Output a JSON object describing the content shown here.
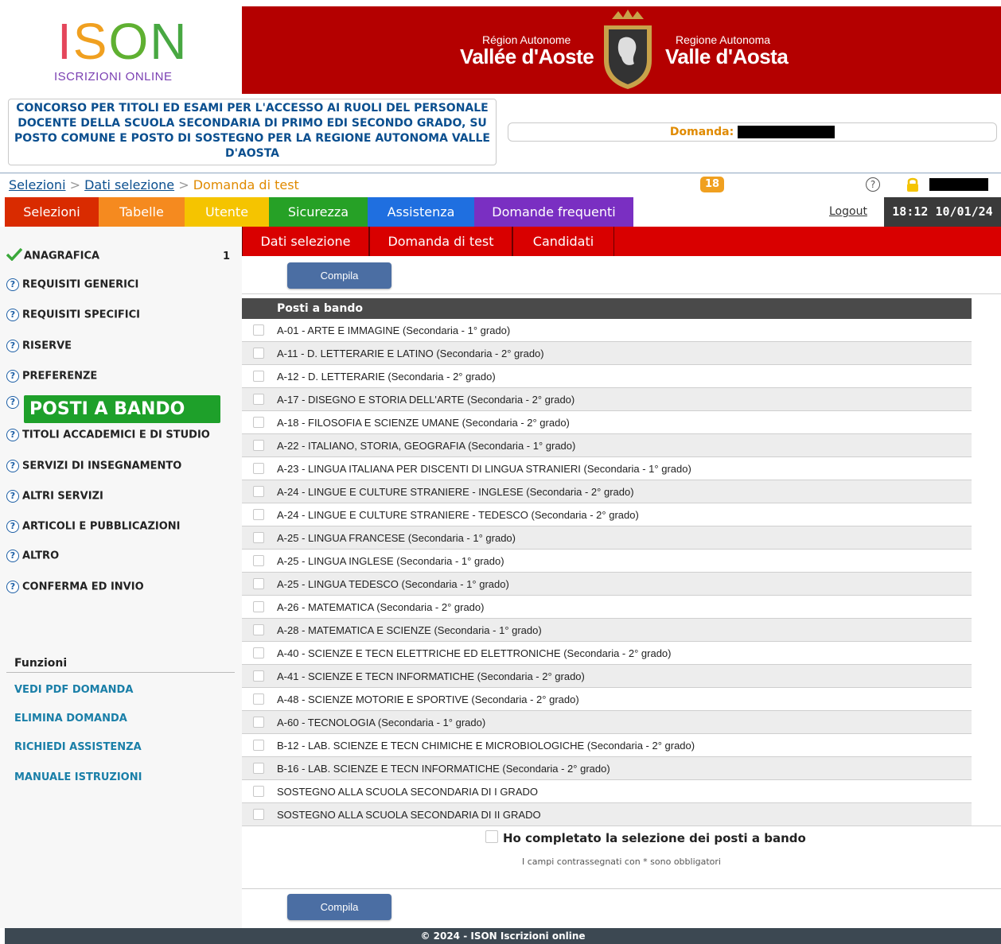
{
  "logo": {
    "letters": [
      "I",
      "S",
      "O",
      "N"
    ],
    "subtitle": "ISCRIZIONI ONLINE"
  },
  "region": {
    "fr_small": "Région Autonome",
    "fr_big": "Vallée d'Aoste",
    "it_small": "Regione Autonoma",
    "it_big": "Valle d'Aosta"
  },
  "concorso_title": "CONCORSO PER TITOLI ED ESAMI PER L'ACCESSO AI RUOLI DEL PERSONALE DOCENTE DELLA SCUOLA SECONDARIA DI PRIMO EDI SECONDO GRADO, SU POSTO COMUNE E POSTO DI SOSTEGNO PER LA REGIONE AUTONOMA VALLE D'AOSTA",
  "domanda_label": "Domanda:",
  "breadcrumb": {
    "items": [
      "Selezioni",
      "Dati selezione",
      "Domanda di test"
    ],
    "separator": ">"
  },
  "badge_count": "18",
  "nav": {
    "items": [
      {
        "label": "Selezioni",
        "color": "#d92b00"
      },
      {
        "label": "Tabelle",
        "color": "#f58a1f"
      },
      {
        "label": "Utente",
        "color": "#f5c400"
      },
      {
        "label": "Sicurezza",
        "color": "#26a126"
      },
      {
        "label": "Assistenza",
        "color": "#1f6fe0"
      },
      {
        "label": "Domande frequenti",
        "color": "#7a2fc2"
      }
    ],
    "logout": "Logout",
    "datetime": "18:12 10/01/24"
  },
  "subtabs": [
    "Dati selezione",
    "Domanda di test",
    "Candidati"
  ],
  "sidebar": {
    "sections": [
      {
        "label": "ANAGRAFICA",
        "status": "done",
        "count": "1"
      },
      {
        "label": "REQUISITI GENERICI",
        "status": "help"
      },
      {
        "label": "REQUISITI SPECIFICI",
        "status": "help"
      },
      {
        "label": "RISERVE",
        "status": "help"
      },
      {
        "label": "PREFERENZE",
        "status": "help"
      },
      {
        "label": "POSTI A BANDO",
        "status": "active"
      },
      {
        "label": "TITOLI ACCADEMICI E DI STUDIO",
        "status": "help"
      },
      {
        "label": "SERVIZI DI INSEGNAMENTO",
        "status": "help"
      },
      {
        "label": "ALTRI SERVIZI",
        "status": "help"
      },
      {
        "label": "ARTICOLI E PUBBLICAZIONI",
        "status": "help"
      },
      {
        "label": "ALTRO",
        "status": "help"
      },
      {
        "label": "CONFERMA ED INVIO",
        "status": "help"
      }
    ],
    "funzioni_title": "Funzioni",
    "funzioni": [
      "VEDI PDF DOMANDA",
      "ELIMINA DOMANDA",
      "RICHIEDI ASSISTENZA",
      "MANUALE ISTRUZIONI"
    ]
  },
  "compila_label": "Compila",
  "table": {
    "header": "Posti a bando",
    "rows": [
      "A-01 - ARTE E IMMAGINE (Secondaria - 1° grado)",
      "A-11 - D. LETTERARIE E LATINO (Secondaria - 2° grado)",
      "A-12 - D. LETTERARIE (Secondaria - 2° grado)",
      "A-17 - DISEGNO E STORIA DELL'ARTE (Secondaria - 2° grado)",
      "A-18 - FILOSOFIA E SCIENZE UMANE (Secondaria - 2° grado)",
      "A-22 - ITALIANO, STORIA, GEOGRAFIA (Secondaria - 1° grado)",
      "A-23 - LINGUA ITALIANA PER DISCENTI DI LINGUA STRANIERI (Secondaria - 1° grado)",
      "A-24 - LINGUE E CULTURE STRANIERE - INGLESE (Secondaria - 2° grado)",
      "A-24 - LINGUE E CULTURE STRANIERE - TEDESCO (Secondaria - 2° grado)",
      "A-25 - LINGUA FRANCESE (Secondaria - 1° grado)",
      "A-25 - LINGUA INGLESE (Secondaria - 1° grado)",
      "A-25 - LINGUA TEDESCO (Secondaria - 1° grado)",
      "A-26 - MATEMATICA (Secondaria - 2° grado)",
      "A-28 - MATEMATICA E SCIENZE (Secondaria - 1° grado)",
      "A-40 - SCIENZE E TECN ELETTRICHE ED ELETTRONICHE (Secondaria - 2° grado)",
      "A-41 - SCIENZE E TECN INFORMATICHE (Secondaria - 2° grado)",
      "A-48 - SCIENZE MOTORIE E SPORTIVE (Secondaria - 2° grado)",
      "A-60 - TECNOLOGIA (Secondaria - 1° grado)",
      "B-12 - LAB. SCIENZE E TECN CHIMICHE E MICROBIOLOGICHE (Secondaria - 2° grado)",
      "B-16 - LAB. SCIENZE E TECN INFORMATICHE (Secondaria - 2° grado)",
      "SOSTEGNO ALLA SCUOLA SECONDARIA DI I GRADO",
      "SOSTEGNO ALLA SCUOLA SECONDARIA DI II GRADO"
    ]
  },
  "completed_label": "Ho completato la selezione dei posti a bando",
  "required_note": "I campi contrassegnati con * sono obbligatori",
  "footer": "© 2024 - ISON Iscrizioni online"
}
